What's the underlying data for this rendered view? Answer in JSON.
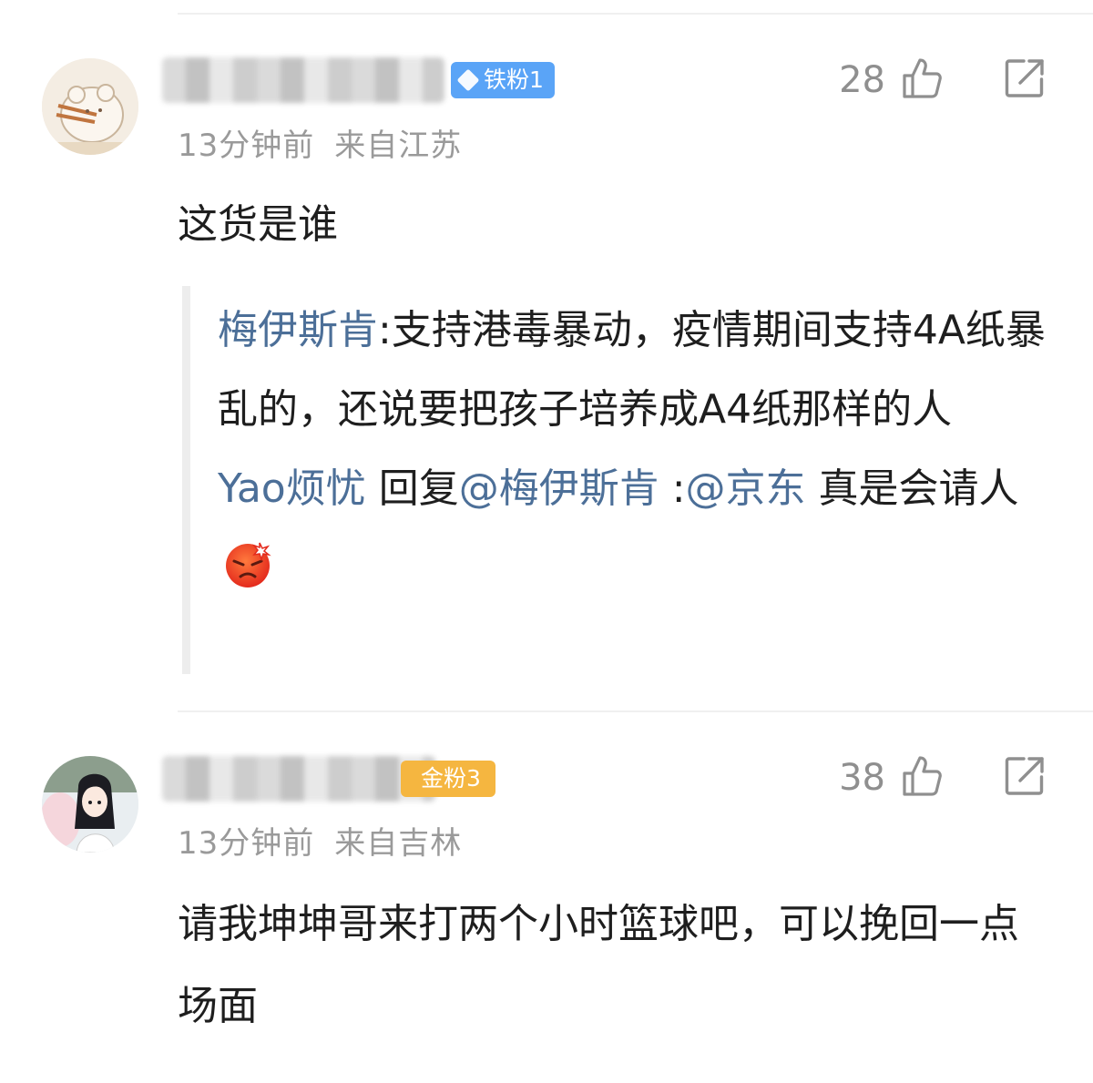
{
  "comments": [
    {
      "badge": {
        "label": "铁粉1",
        "color": "#5aa4f7"
      },
      "time": "13分钟前",
      "location": "来自江苏",
      "likes": "28",
      "text": "这货是谁",
      "replies": [
        {
          "author": "梅伊斯肯",
          "separator": ":",
          "text": "支持港毒暴动，疫情期间支持4A纸暴乱的，还说要把孩子培养成A4纸那样的人"
        },
        {
          "author": "Yao烦忧",
          "reply_word": " 回复",
          "mention": "@梅伊斯肯",
          "colon": " :",
          "mention2": "@京东",
          "text": " 真是会请人",
          "emoji": "angry-face"
        }
      ]
    },
    {
      "badge": {
        "label": "金粉3",
        "color": "#f5b640"
      },
      "time": "13分钟前",
      "location": "来自吉林",
      "likes": "38",
      "text": "请我坤坤哥来打两个小时篮球吧，可以挽回一点场面"
    }
  ],
  "icons": {
    "like": "thumbs-up-icon",
    "share": "share-icon"
  },
  "colors": {
    "link": "#4c6f98",
    "meta": "#9a9a9a",
    "divider": "#f0f0f0"
  }
}
